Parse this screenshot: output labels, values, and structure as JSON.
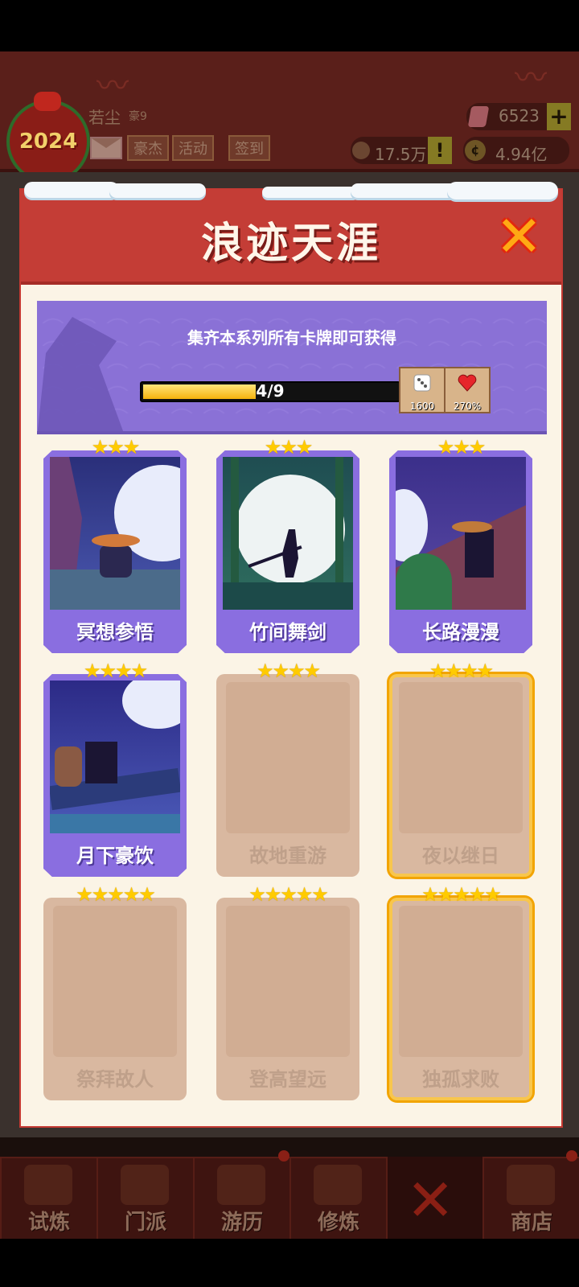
{
  "top": {
    "badge_year": "2024",
    "username": "若尘",
    "user_level": "豪9",
    "buttons": [
      "豪杰",
      "活动",
      "签到"
    ],
    "gems": "6523",
    "plus": "+",
    "resource1": "17.5万",
    "resource1_alert": "!",
    "resource2": "4.94亿"
  },
  "modal": {
    "title": "浪迹天涯",
    "close_label": "✕",
    "banner_text": "集齐本系列所有卡牌即可获得",
    "progress_text": "4/9",
    "progress_fraction": 0.444,
    "rewards": [
      {
        "icon": "dice-icon",
        "value": "1600"
      },
      {
        "icon": "heart-icon",
        "value": "270%"
      }
    ],
    "cards": [
      {
        "name": "冥想参悟",
        "stars": "★★★",
        "unlocked": true
      },
      {
        "name": "竹间舞剑",
        "stars": "★★★",
        "unlocked": true
      },
      {
        "name": "长路漫漫",
        "stars": "★★★",
        "unlocked": true
      },
      {
        "name": "月下豪饮",
        "stars": "★★★★",
        "unlocked": true
      },
      {
        "name": "故地重游",
        "stars": "★★★★",
        "unlocked": false
      },
      {
        "name": "夜以继日",
        "stars": "★★★★",
        "unlocked": false
      },
      {
        "name": "祭拜故人",
        "stars": "★★★★★",
        "unlocked": false
      },
      {
        "name": "登高望远",
        "stars": "★★★★★",
        "unlocked": false
      },
      {
        "name": "独孤求败",
        "stars": "★★★★★",
        "unlocked": false
      }
    ]
  },
  "bottom_nav": [
    "试炼",
    "门派",
    "游历",
    "修炼",
    "",
    "商店"
  ],
  "colors": {
    "header_red": "#c43d36",
    "card_purple": "#8a6ee0",
    "locked_tan": "#d9b8a0",
    "gold": "#f2a400"
  }
}
